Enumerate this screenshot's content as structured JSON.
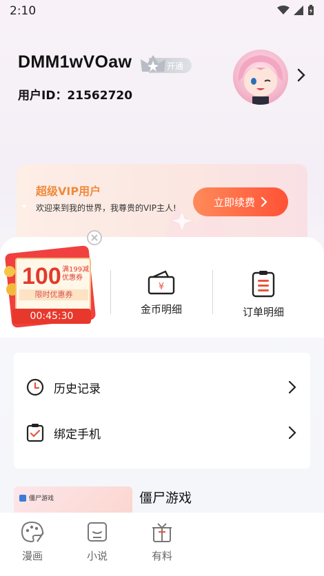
{
  "status_bar": {
    "time": "2:10"
  },
  "profile": {
    "username": "DMM1wVOaw",
    "vip_badge_label": "开通",
    "user_id_text": "用户ID：21562720"
  },
  "vip_card": {
    "title": "超级VIP用户",
    "description": "欢迎来到我的世界，我尊贵的VIP主人!",
    "renew_button": "立即续费"
  },
  "coupon": {
    "amount": "100",
    "condition": "满199减优惠券",
    "limit_label": "限时优惠券",
    "timer": "00:45:30"
  },
  "wallet": [
    {
      "label": "金币明细",
      "icon": "coin-wallet-icon"
    },
    {
      "label": "订单明细",
      "icon": "order-list-icon"
    }
  ],
  "menu": [
    {
      "label": "历史记录",
      "icon": "clock-icon"
    },
    {
      "label": "绑定手机",
      "icon": "clipboard-check-icon"
    }
  ],
  "promo": {
    "title": "僵尸游戏",
    "thumb_caption": "僵尸游戏"
  },
  "bottom_nav": [
    {
      "label": "漫画",
      "icon": "palette-icon"
    },
    {
      "label": "小说",
      "icon": "book-icon"
    },
    {
      "label": "有料",
      "icon": "gift-icon"
    }
  ],
  "colors": {
    "accent": "#ff5236",
    "vip_title": "#f08a3c",
    "coupon_red": "#e33a2c"
  }
}
